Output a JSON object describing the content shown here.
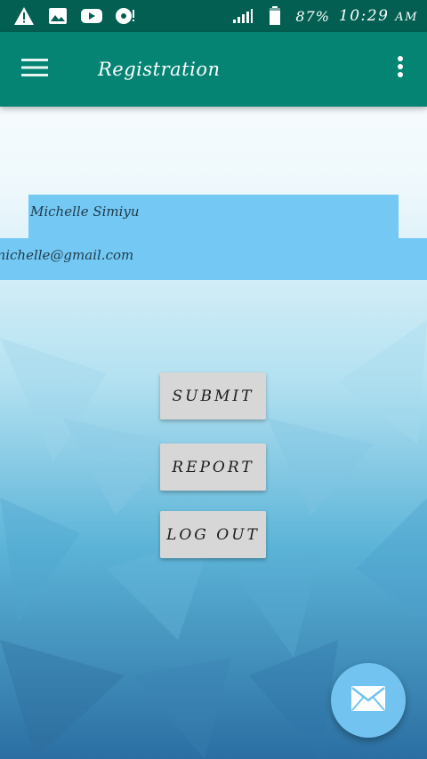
{
  "status_bar": {
    "icons": [
      "warning-icon",
      "image-icon",
      "youtube-icon",
      "disc-alert-icon",
      "signal-icon",
      "battery-icon"
    ],
    "battery": "87%",
    "time": "10:29",
    "meridiem": "AM"
  },
  "app_bar": {
    "title": "Registration",
    "menu_icon": "hamburger-menu-icon",
    "overflow_icon": "more-vert-icon",
    "color": "#058473"
  },
  "form": {
    "name_value": "Michelle Simiyu",
    "email_value": "michelle@gmail.com",
    "field_color": "#74c8f4"
  },
  "buttons": {
    "submit_label": "SUBMIT",
    "report_label": "REPORT",
    "logout_label": "LOG OUT"
  },
  "fab": {
    "icon": "mail-icon",
    "color": "#72c3ef"
  }
}
